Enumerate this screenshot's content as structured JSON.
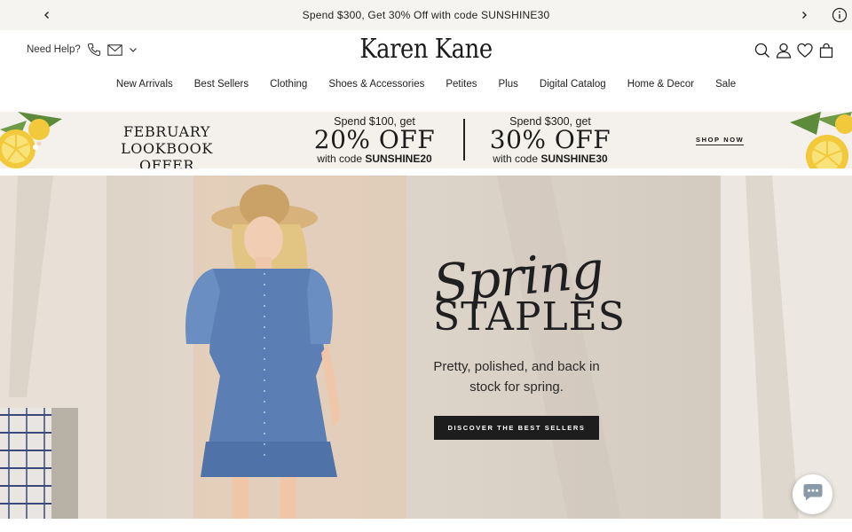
{
  "announcement": {
    "text": "Spend $300, Get 30% Off with code SUNSHINE30",
    "prev_icon": "chevron-left-icon",
    "next_icon": "chevron-right-icon",
    "info_icon": "info-icon"
  },
  "header": {
    "help_label": "Need Help?",
    "help_icons": [
      "phone-icon",
      "mail-icon",
      "chevron-down-icon"
    ],
    "logo_text": "Karen Kane",
    "utility_icons": [
      "search-icon",
      "account-icon",
      "wishlist-heart-icon",
      "shopping-bag-icon"
    ]
  },
  "nav": {
    "items": [
      {
        "label": "New Arrivals"
      },
      {
        "label": "Best Sellers"
      },
      {
        "label": "Clothing"
      },
      {
        "label": "Shoes & Accessories"
      },
      {
        "label": "Petites"
      },
      {
        "label": "Plus"
      },
      {
        "label": "Digital Catalog"
      },
      {
        "label": "Home & Decor"
      },
      {
        "label": "Sale"
      }
    ]
  },
  "promo": {
    "lookbook_line1": "FEBRUARY",
    "lookbook_line2": "LOOKBOOK OFFER",
    "offer1": {
      "top": "Spend $100, get",
      "big": "20% OFF",
      "code_prefix": "with code ",
      "code": "SUNSHINE20"
    },
    "offer2": {
      "top": "Spend $300, get",
      "big": "30% OFF",
      "code_prefix": "with code ",
      "code": "SUNSHINE30"
    },
    "shop_now": "SHOP NOW"
  },
  "hero": {
    "script_title": "Spring",
    "title": "STAPLES",
    "tagline_line1": "Pretty, polished, and back in",
    "tagline_line2": "stock for spring.",
    "cta_label": "DISCOVER THE BEST SELLERS"
  },
  "chat": {
    "icon": "chat-bubble-icon"
  },
  "colors": {
    "announcement_bg": "#f6f4f1",
    "promo_bg": "#f4f1ec",
    "cta_bg": "#1d1d1d",
    "dress_blue": "#5b7fb4",
    "lemon_yellow": "#f2c93a"
  }
}
